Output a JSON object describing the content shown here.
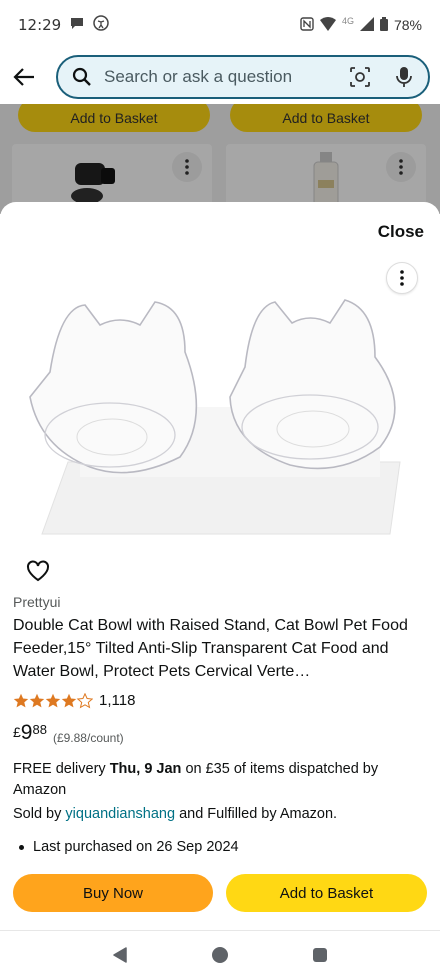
{
  "status_bar": {
    "time": "12:29",
    "network": "4G",
    "battery": "78%"
  },
  "search": {
    "placeholder": "Search or ask a question"
  },
  "background": {
    "left_button": "Add to Basket",
    "right_button": "Add to Basket"
  },
  "sheet": {
    "close_label": "Close",
    "brand": "Prettyui",
    "title": "Double Cat Bowl with Raised Stand, Cat Bowl Pet Food Feeder,15° Tilted Anti-Slip Transparent Cat Food and Water Bowl, Protect Pets Cervical Verte…",
    "rating": 4.5,
    "rating_count": "1,118",
    "price": {
      "symbol": "£",
      "whole": "9",
      "fraction": "88",
      "unit": "(£9.88/count)"
    },
    "delivery": {
      "prefix": "FREE delivery ",
      "date": "Thu, 9 Jan",
      "suffix": " on £35 of items dispatched by Amazon"
    },
    "sold_by": {
      "prefix": "Sold by ",
      "seller": "yiquandianshang",
      "suffix": " and Fulfilled by Amazon."
    },
    "last_purchased": "Last purchased on 26 Sep 2024",
    "buy_now_label": "Buy Now",
    "add_to_basket_label": "Add to Basket"
  },
  "colors": {
    "buy_now": "#ffa41c",
    "add_to_basket": "#ffd814",
    "link": "#007185",
    "star": "#de7921",
    "search_border": "#1a5f7a"
  }
}
